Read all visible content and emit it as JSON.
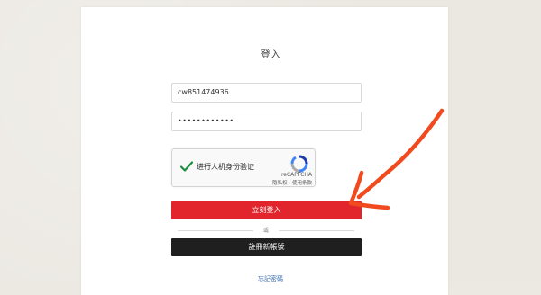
{
  "form": {
    "title": "登入",
    "username_value": "cw851474936",
    "password_value": "••••••••••••",
    "login_label": "立刻登入",
    "or_label": "或",
    "register_label": "註冊新帳號",
    "forgot_label": "忘記密碼"
  },
  "captcha": {
    "label": "进行人机身份验证",
    "brand": "reCAPTCHA",
    "links": "隐私权 - 使用条款",
    "checked": true
  },
  "colors": {
    "login_button": "#e2242c",
    "register_button": "#1f1f1f",
    "annotation_arrow": "#f04a1e",
    "check_mark": "#1e8e3e"
  },
  "icons": {
    "check": "check-icon",
    "recaptcha_logo": "recaptcha-logo-icon",
    "arrow": "arrow-annotation"
  }
}
